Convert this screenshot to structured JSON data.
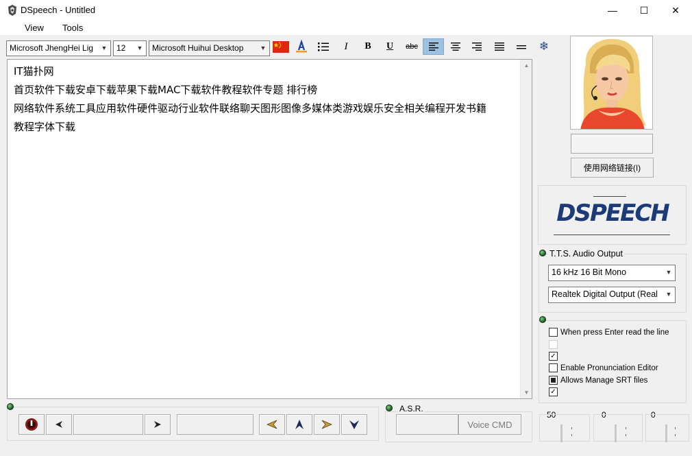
{
  "window": {
    "title": "DSpeech - Untitled",
    "controls": {
      "minimize": "—",
      "maximize": "☐",
      "close": "✕"
    }
  },
  "menu": [
    "View",
    "Tools"
  ],
  "toolbar": {
    "font_latin": "Microsoft JhengHei Lig",
    "font_size": "12",
    "font_east_asian": "Microsoft Huihui Desktop",
    "italic": "I",
    "bold": "B",
    "underline": "U",
    "strike": "abc"
  },
  "editor": {
    "lines": [
      "IT猫扑网",
      "首页软件下载安卓下载苹果下载MAC下载软件教程软件专题 排行榜",
      "网络软件系统工具应用软件硬件驱动行业软件联络聊天图形图像多媒体类游戏娱乐安全相关编程开发书籍",
      "教程字体下载"
    ]
  },
  "voice_panel": {
    "link_button": "使用网络链接(I)",
    "logo_text": "DSPEECH"
  },
  "tts": {
    "title": "T.T.S. Audio Output",
    "format": "16 kHz 16 Bit Mono",
    "device": "Realtek Digital Output (Real"
  },
  "options": [
    {
      "label": "When press Enter read the line",
      "checked": false
    },
    {
      "label": "",
      "checked": false
    },
    {
      "label": "",
      "checked": true
    },
    {
      "label": "Enable Pronunciation Editor",
      "checked": false
    },
    {
      "label": "Allows Manage SRT files",
      "checked": "partial"
    },
    {
      "label": "",
      "checked": true
    }
  ],
  "asr": {
    "title": "A.S.R.",
    "voice_cmd": "Voice CMD"
  },
  "sliders": {
    "rate": "50",
    "pitch": "0",
    "volume": "0"
  },
  "colors": {
    "selected_tool": "#9fc1e0",
    "logo": "#1c3b78",
    "avatar_dress": "#e8472b"
  }
}
